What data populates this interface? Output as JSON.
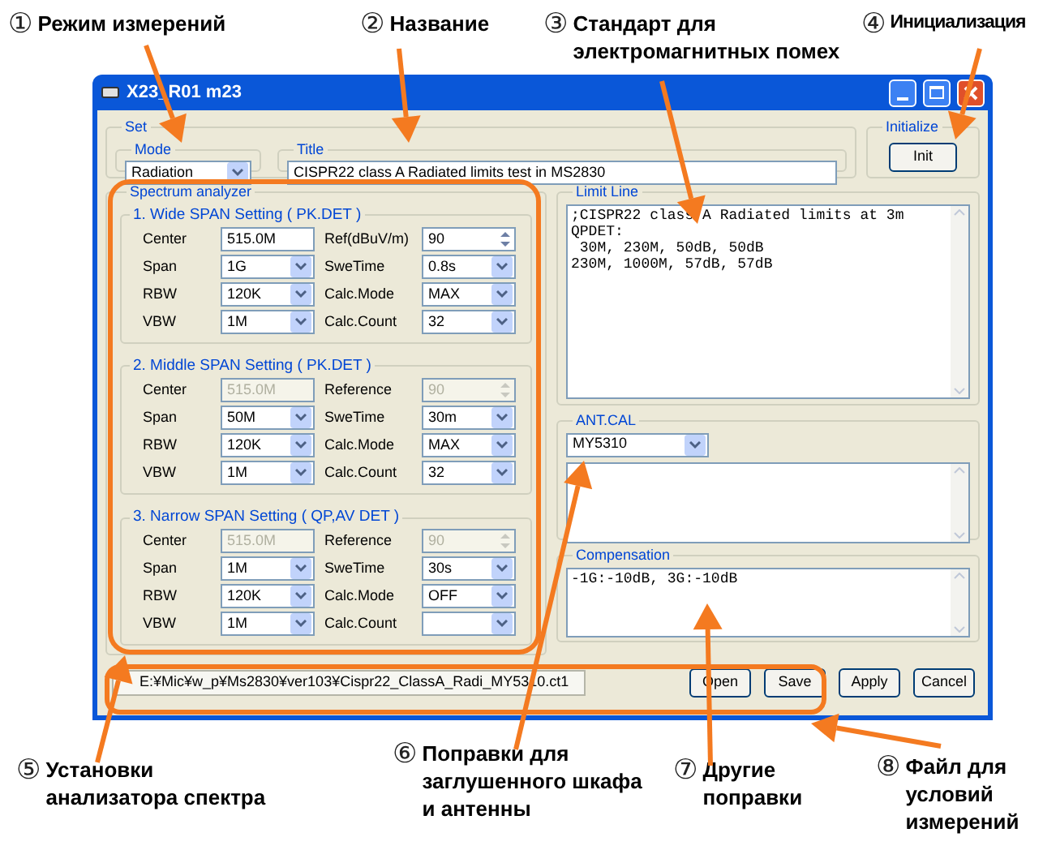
{
  "callouts_top": [
    {
      "number": "①",
      "lines": [
        "Режим измерений"
      ]
    },
    {
      "number": "②",
      "lines": [
        "Название"
      ]
    },
    {
      "number": "③",
      "lines": [
        "Стандарт для",
        "электромагнитных помех"
      ]
    },
    {
      "number": "④",
      "lines": [
        "Инициализация"
      ]
    }
  ],
  "window": {
    "title": "X23_R01 m23"
  },
  "setting": {
    "label": "Set",
    "mode": {
      "label": "Mode",
      "value": "Radiation"
    },
    "title": {
      "label": "Title",
      "value": "CISPR22 class A Radiated limits test in MS2830"
    }
  },
  "initialize": {
    "label": "Initialize",
    "button": "Init"
  },
  "spectrum_analyzer": {
    "label": "Spectrum analyzer",
    "sections": [
      {
        "title": "1. Wide SPAN Setting ( PK.DET )",
        "fields": [
          {
            "label": "Center",
            "kind": "text",
            "value": "515.0M",
            "disabled": false
          },
          {
            "label": "Ref(dBuV/m)",
            "kind": "spin",
            "value": "90",
            "disabled": false
          },
          {
            "label": "Span",
            "kind": "combo",
            "value": "1G",
            "disabled": false
          },
          {
            "label": "SweTime",
            "kind": "combo",
            "value": "0.8s",
            "disabled": false
          },
          {
            "label": "RBW",
            "kind": "combo",
            "value": "120K",
            "disabled": false
          },
          {
            "label": "Calc.Mode",
            "kind": "combo",
            "value": "MAX",
            "disabled": false
          },
          {
            "label": "VBW",
            "kind": "combo",
            "value": "1M",
            "disabled": false
          },
          {
            "label": "Calc.Count",
            "kind": "combo",
            "value": "32",
            "disabled": false
          }
        ]
      },
      {
        "title": "2. Middle SPAN Setting ( PK.DET )",
        "fields": [
          {
            "label": "Center",
            "kind": "text",
            "value": "515.0M",
            "disabled": true
          },
          {
            "label": "Reference",
            "kind": "spin",
            "value": "90",
            "disabled": true
          },
          {
            "label": "Span",
            "kind": "combo",
            "value": "50M",
            "disabled": false
          },
          {
            "label": "SweTime",
            "kind": "combo",
            "value": "30m",
            "disabled": false
          },
          {
            "label": "RBW",
            "kind": "combo",
            "value": "120K",
            "disabled": false
          },
          {
            "label": "Calc.Mode",
            "kind": "combo",
            "value": "MAX",
            "disabled": false
          },
          {
            "label": "VBW",
            "kind": "combo",
            "value": "1M",
            "disabled": false
          },
          {
            "label": "Calc.Count",
            "kind": "combo",
            "value": "32",
            "disabled": false
          }
        ]
      },
      {
        "title": "3. Narrow SPAN Setting ( QP,AV DET )",
        "fields": [
          {
            "label": "Center",
            "kind": "text",
            "value": "515.0M",
            "disabled": true
          },
          {
            "label": "Reference",
            "kind": "spin",
            "value": "90",
            "disabled": true
          },
          {
            "label": "Span",
            "kind": "combo",
            "value": "1M",
            "disabled": false
          },
          {
            "label": "SweTime",
            "kind": "combo",
            "value": "30s",
            "disabled": false
          },
          {
            "label": "RBW",
            "kind": "combo",
            "value": "120K",
            "disabled": false
          },
          {
            "label": "Calc.Mode",
            "kind": "combo",
            "value": "OFF",
            "disabled": false
          },
          {
            "label": "VBW",
            "kind": "combo",
            "value": "1M",
            "disabled": false
          },
          {
            "label": "Calc.Count",
            "kind": "combo",
            "disabled": false
          }
        ]
      }
    ]
  },
  "limit_line": {
    "label": "Limit Line",
    "lines": [
      ";CISPR22 class A Radiated limits at 3m",
      "QPDET:",
      " 30M, 230M, 50dB, 50dB",
      "230M, 1000M, 57dB, 57dB"
    ]
  },
  "ant_cal": {
    "label": "ANT.CAL",
    "value": "MY5310"
  },
  "compensation": {
    "label": "Compensation",
    "value": "-1G:-10dB, 3G:-10dB"
  },
  "file": {
    "path": "E:¥Mic¥w_p¥Ms2830¥ver103¥Cispr22_ClassA_Radi_MY5310.ct1",
    "buttons": [
      "Open",
      "Save"
    ]
  },
  "dialog_buttons": [
    "Apply",
    "Cancel"
  ],
  "callouts_bottom": [
    {
      "number": "⑤",
      "lines": [
        "Установки",
        "анализатора спектра"
      ]
    },
    {
      "number": "⑥",
      "lines": [
        "Поправки для",
        "заглушенного шкафа",
        "и антенны"
      ]
    },
    {
      "number": "⑦",
      "lines": [
        "Другие",
        "поправки"
      ]
    },
    {
      "number": "⑧",
      "lines": [
        "Файл для",
        "условий",
        "измерений"
      ]
    }
  ]
}
